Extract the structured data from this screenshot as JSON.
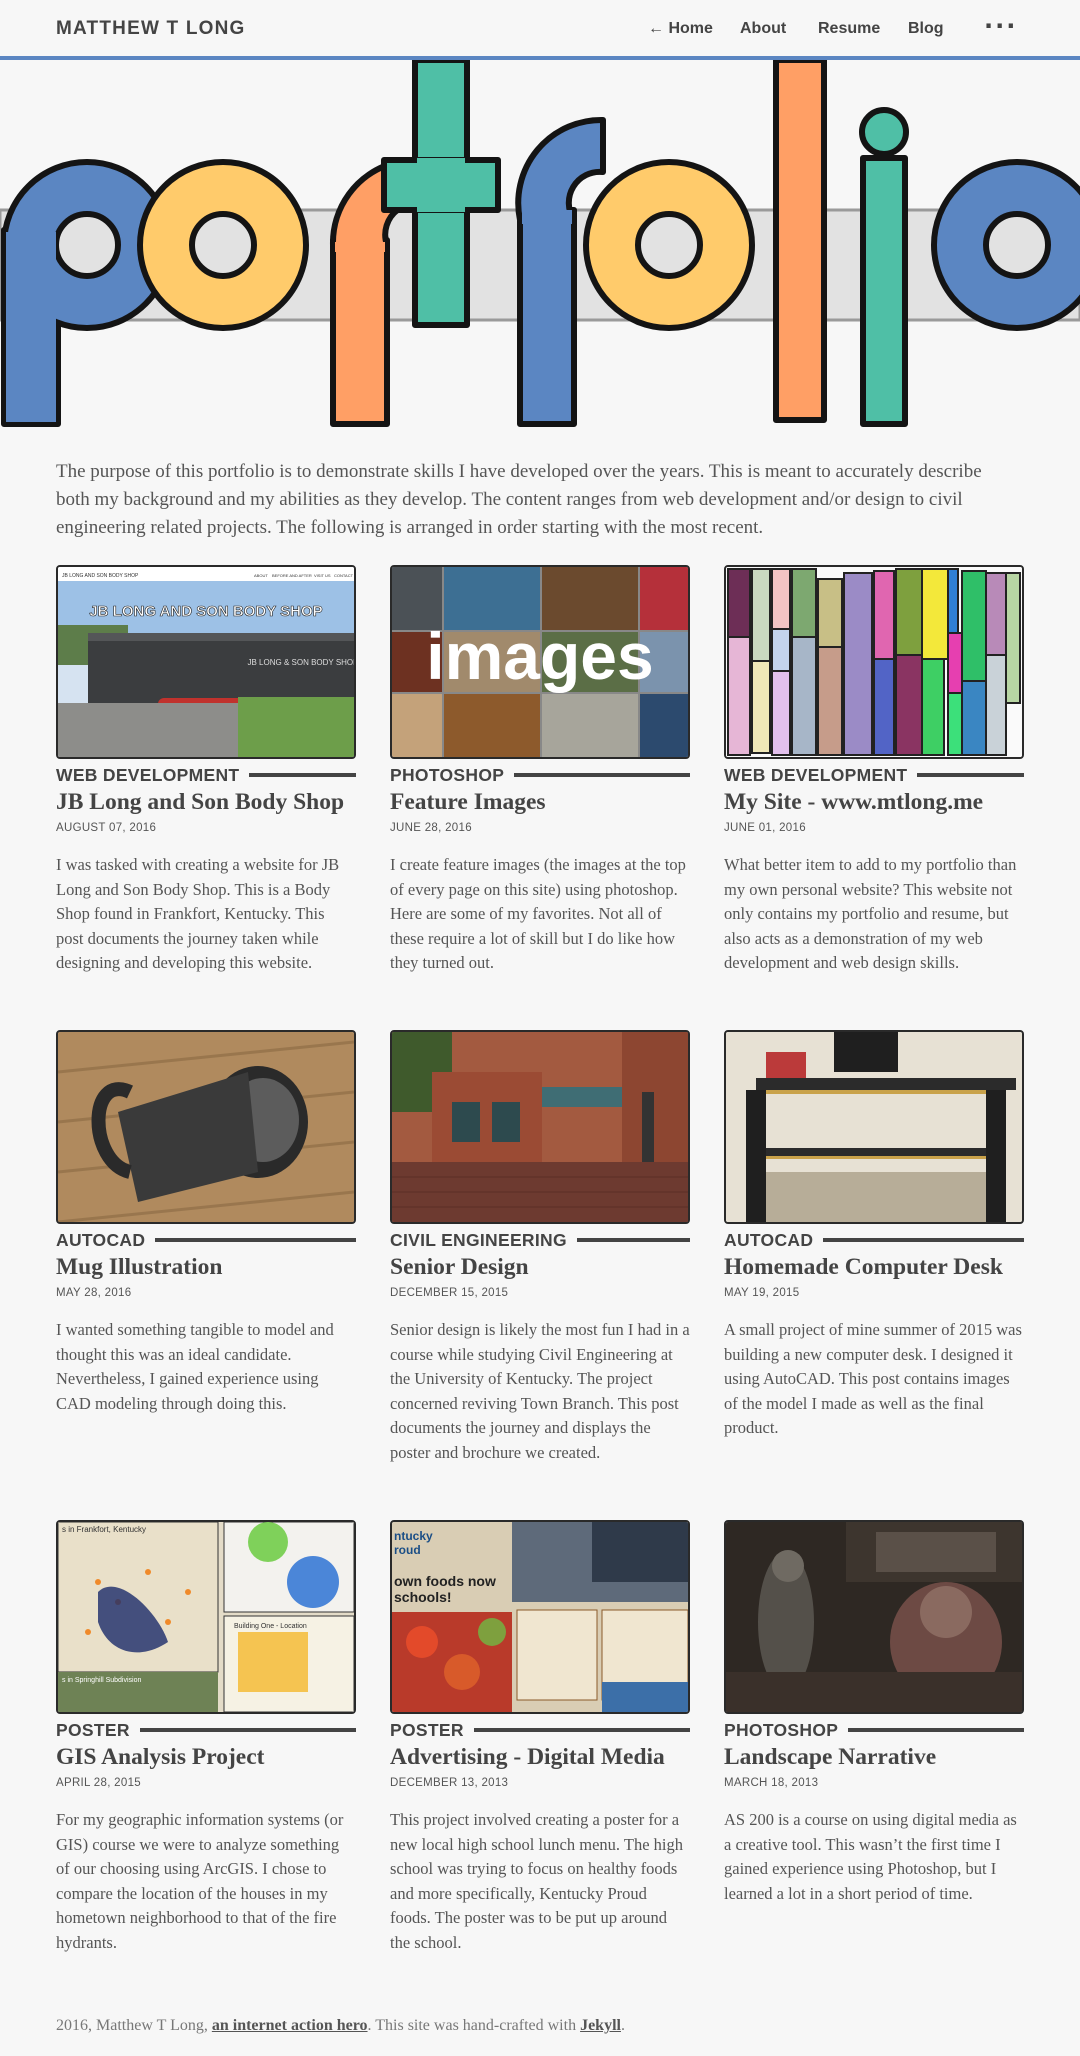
{
  "header": {
    "site_title": "MATTHEW T LONG",
    "nav": [
      {
        "label": "← Home"
      },
      {
        "label": "About"
      },
      {
        "label": "Resume"
      },
      {
        "label": "Blog"
      }
    ],
    "more_label": "···"
  },
  "hero": {
    "word": "portfolio",
    "colors": {
      "blue": "#5b86c2",
      "yellow": "#ffcb6b",
      "orange": "#ff9f65",
      "teal": "#4fbfa6",
      "band": "#e2e2e2",
      "outline": "#141414"
    }
  },
  "intro": "The purpose of this portfolio is to demonstrate skills I have developed over the years. This is meant to accurately describe both my background and my abilities as they develop. The content ranges from web development and/or design to civil engineering related projects. The following is arranged in order starting with the most recent.",
  "cards": [
    {
      "category": "WEB DEVELOPMENT",
      "title": "JB Long and Son Body Shop",
      "date": "AUGUST 07, 2016",
      "description": "I was tasked with creating a website for JB Long and Son Body Shop. This is a Body Shop found in Frankfort, Kentucky. This post documents the journey taken while designing and developing this website.",
      "thumb": {
        "banner": "JB LONG AND SON BODY SHOP",
        "brand_small": "JB LONG AND SON BODY SHOP",
        "menu": [
          "ABOUT",
          "BEFORE AND AFTER",
          "VISIT US",
          "CONTACT"
        ],
        "sign": "JB LONG & SON BODY SHOP"
      }
    },
    {
      "category": "PHOTOSHOP",
      "title": "Feature Images",
      "date": "JUNE 28, 2016",
      "description": "I create feature images (the images at the top of every page on this site) using photoshop. Here are some of my favorites. Not all of these require a lot of skill but I do like how they turned out.",
      "thumb": {
        "overlay_text": "images"
      }
    },
    {
      "category": "WEB DEVELOPMENT",
      "title": "My Site - www.mtlong.me",
      "date": "JUNE 01, 2016",
      "description": "What better item to add to my portfolio than my own personal website? This website not only contains my portfolio and resume, but also acts as a demonstration of my web development and web design skills.",
      "thumb": {}
    },
    {
      "category": "AUTOCAD",
      "title": "Mug Illustration",
      "date": "MAY 28, 2016",
      "description": "I wanted something tangible to model and thought this was an ideal candidate. Nevertheless, I gained experience using CAD modeling through doing this.",
      "thumb": {}
    },
    {
      "category": "CIVIL ENGINEERING",
      "title": "Senior Design",
      "date": "DECEMBER 15, 2015",
      "description": "Senior design is likely the most fun I had in a course while studying Civil Engineering at the University of Kentucky. The project concerned reviving Town Branch. This post documents the journey and displays the poster and brochure we created.",
      "thumb": {}
    },
    {
      "category": "AUTOCAD",
      "title": "Homemade Computer Desk",
      "date": "MAY 19, 2015",
      "description": "A small project of mine summer of 2015 was building a new computer desk. I designed it using AutoCAD. This post contains images of the model I made as well as the final product.",
      "thumb": {}
    },
    {
      "category": "POSTER",
      "title": "GIS Analysis Project",
      "date": "APRIL 28, 2015",
      "description": "For my geographic information systems (or GIS) course we were to analyze something of our choosing using ArcGIS. I chose to compare the location of the houses in my hometown neighborhood to that of the fire hydrants.",
      "thumb": {
        "label1": "s in Frankfort, Kentucky",
        "label2": "Building One - Location",
        "label3": "s in Springhill Subdivision"
      }
    },
    {
      "category": "POSTER",
      "title": "Advertising - Digital Media",
      "date": "DECEMBER 13, 2013",
      "description": "This project involved creating a poster for a new local high school lunch menu. The high school was trying to focus on healthy foods and more specifically, Kentucky Proud foods. The poster was to be put up around the school.",
      "thumb": {
        "brand1": "ntucky",
        "brand2": "roud",
        "headline1": "own foods now",
        "headline2": "schools!"
      }
    },
    {
      "category": "PHOTOSHOP",
      "title": "Landscape Narrative",
      "date": "MARCH 18, 2013",
      "description": "AS 200 is a course on using digital media as a creative tool. This wasn’t the first time I gained experience using Photoshop, but I learned a lot in a short period of time.",
      "thumb": {}
    }
  ],
  "footer": {
    "prefix": "2016, Matthew T Long, ",
    "link1": "an internet action hero",
    "middle": ". This site was hand-crafted with ",
    "link2": "Jekyll",
    "suffix": "."
  }
}
